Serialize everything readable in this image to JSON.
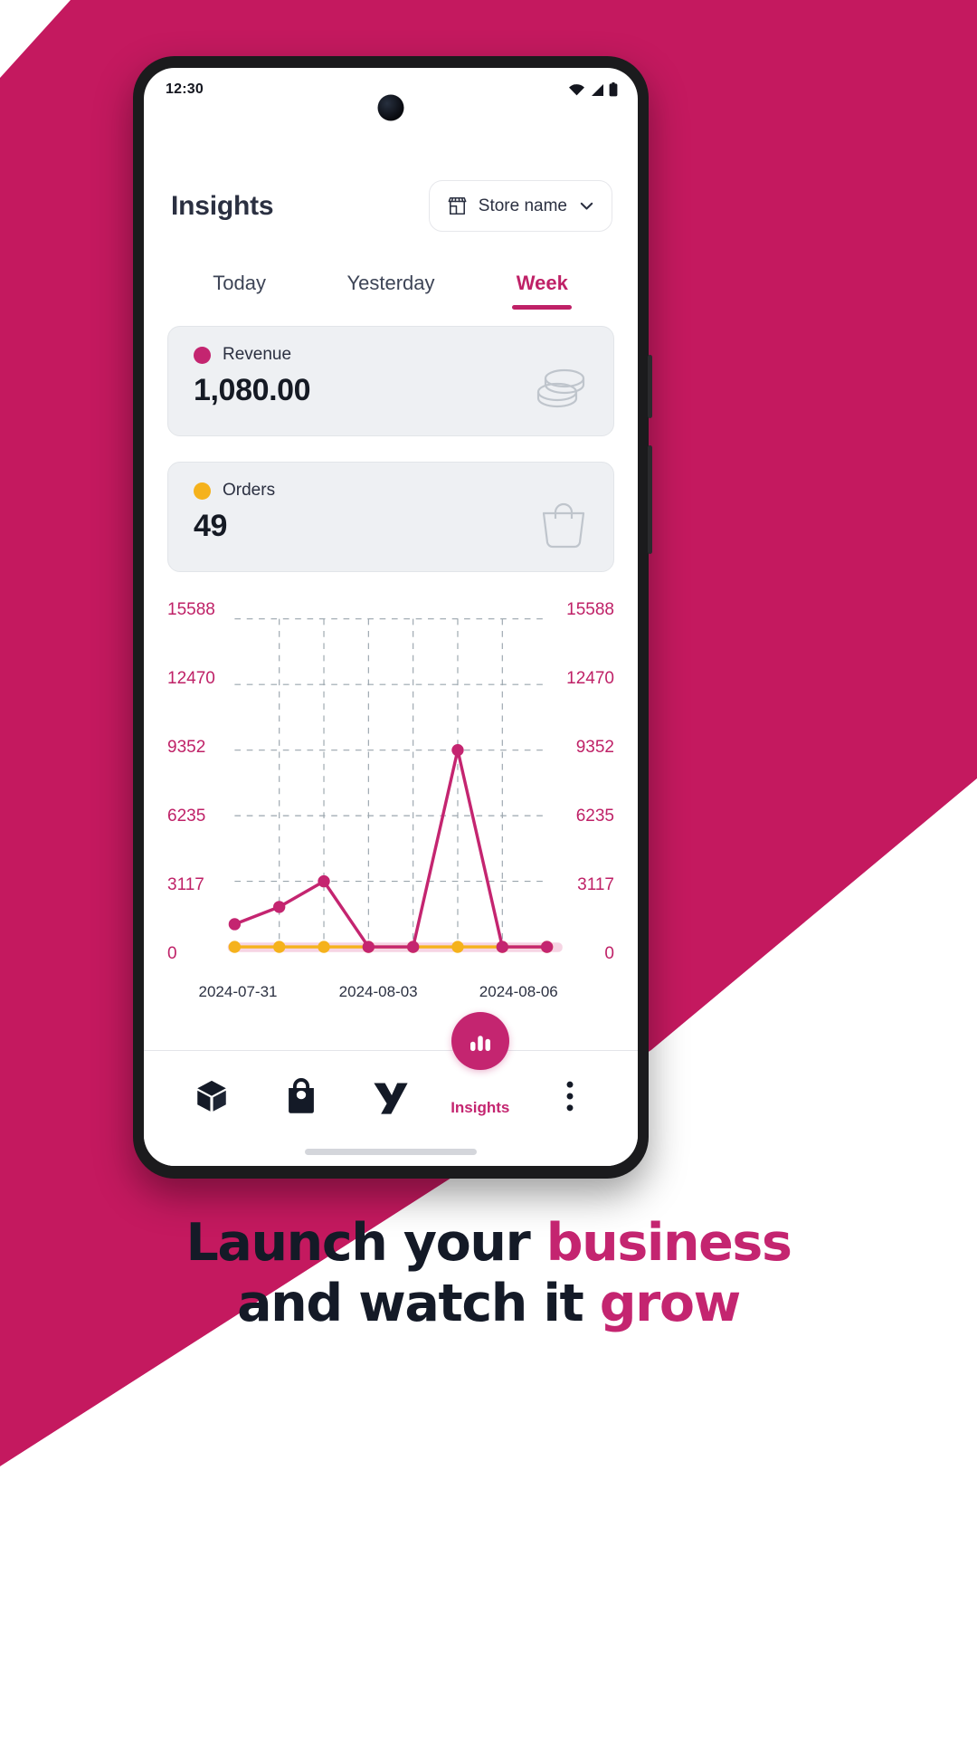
{
  "theme": {
    "brand_magenta": "#c42570",
    "accent_pink": "#bf2167",
    "orders_yellow": "#f5b21c",
    "ink": "#2b3041",
    "card_bg": "#eef0f3"
  },
  "status_bar": {
    "time": "12:30",
    "icons": [
      "wifi-icon",
      "signal-icon",
      "battery-icon"
    ]
  },
  "header": {
    "title": "Insights",
    "store_selector": {
      "icon": "storefront-icon",
      "label": "Store name",
      "chevron": "chevron-down-icon"
    }
  },
  "tabs": [
    {
      "label": "Today",
      "active": false
    },
    {
      "label": "Yesterday",
      "active": false
    },
    {
      "label": "Week",
      "active": true
    }
  ],
  "metrics": [
    {
      "key": "revenue",
      "label": "Revenue",
      "value": "1,080.00",
      "dot_color": "#c42570",
      "icon": "coins-icon"
    },
    {
      "key": "orders",
      "label": "Orders",
      "value": "49",
      "dot_color": "#f5b21c",
      "icon": "shopping-bag-icon"
    }
  ],
  "chart_data": {
    "type": "line",
    "title": "",
    "xlabel": "",
    "ylabel": "",
    "grid": true,
    "legend": "none",
    "ylim": [
      0,
      15588
    ],
    "y_ticks": [
      0,
      3117,
      6235,
      9352,
      12470,
      15588
    ],
    "y_tick_labels_left": [
      "0",
      "3117",
      "6235",
      "9352",
      "12470",
      "15588"
    ],
    "y_tick_labels_right": [
      "0",
      "3117",
      "6235",
      "9352",
      "12470",
      "15588"
    ],
    "x": [
      "2024-07-31",
      "2024-08-01",
      "2024-08-02",
      "2024-08-03",
      "2024-08-04",
      "2024-08-05",
      "2024-08-06",
      "2024-08-07"
    ],
    "x_tick_labels": [
      "2024-07-31",
      "2024-08-03",
      "2024-08-06"
    ],
    "x_tick_indices": [
      0,
      3,
      6
    ],
    "series": [
      {
        "name": "Revenue",
        "color": "#c42570",
        "values": [
          1080,
          1900,
          3117,
          0,
          0,
          9352,
          0,
          0
        ]
      },
      {
        "name": "Orders",
        "color": "#f5b21c",
        "values": [
          0,
          0,
          0,
          0,
          0,
          0,
          0,
          0
        ]
      }
    ]
  },
  "bottom_nav": [
    {
      "key": "products",
      "icon": "cube-icon",
      "label": "",
      "active": false
    },
    {
      "key": "orders",
      "icon": "shopping-bag-icon",
      "label": "",
      "active": false
    },
    {
      "key": "brand",
      "icon": "y-logo-icon",
      "label": "",
      "active": false
    },
    {
      "key": "insights",
      "icon": "bar-chart-icon",
      "label": "Insights",
      "active": true
    },
    {
      "key": "more",
      "icon": "kebab-menu-icon",
      "label": "",
      "active": false
    }
  ],
  "tagline": {
    "line1_plain": "Launch your ",
    "line1_highlight": "business",
    "line2_plain": "and watch it ",
    "line2_highlight": "grow"
  }
}
